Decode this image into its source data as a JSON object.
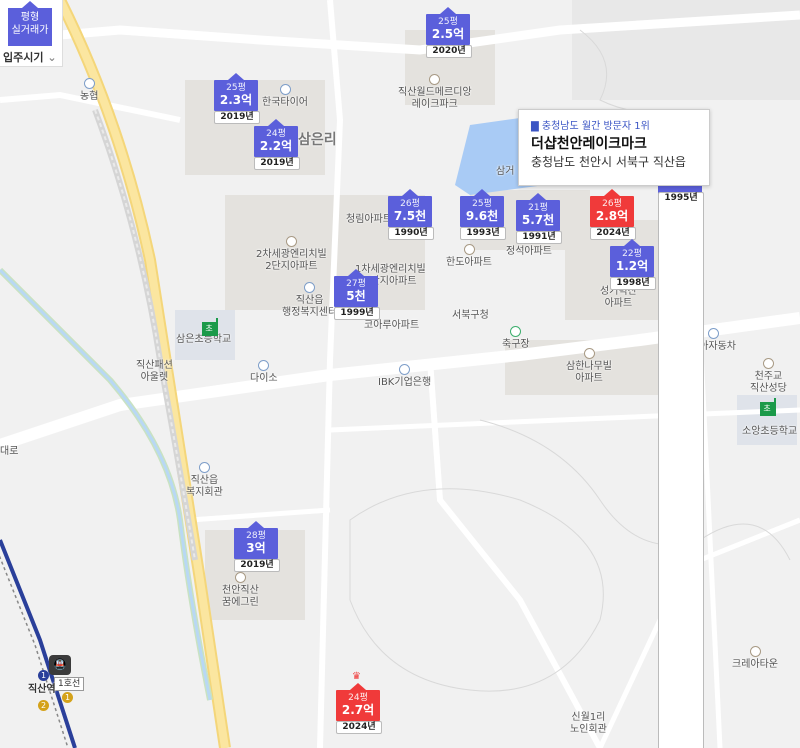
{
  "filter": {
    "type_line1": "평형",
    "type_line2": "실거래가",
    "sort_label": "입주시기",
    "sort_icon": "chevron-down-icon"
  },
  "popup": {
    "rank_icon": "building-icon",
    "rank_text": "충청남도 월간 방문자 1위",
    "name": "더샵천안레이크마크",
    "address": "충청남도 천안시 서북구 직산읍"
  },
  "markers": [
    {
      "pyeong": "25평",
      "price": "2.5억",
      "year": "2020년",
      "highlight": false
    },
    {
      "pyeong": "25평",
      "price": "2.3억",
      "year": "2019년",
      "highlight": false
    },
    {
      "pyeong": "24평",
      "price": "2.2억",
      "year": "2019년",
      "highlight": false
    },
    {
      "pyeong": "26평",
      "price": "7.5천",
      "year": "1990년",
      "highlight": false
    },
    {
      "pyeong": "25평",
      "price": "9.6천",
      "year": "1993년",
      "highlight": false
    },
    {
      "pyeong": "21평",
      "price": "5.7천",
      "year": "1991년",
      "highlight": false
    },
    {
      "pyeong": "26평",
      "price": "2.8억",
      "year": "2024년",
      "highlight": true
    },
    {
      "pyeong": "22평",
      "price": "1.2억",
      "year": "1998년",
      "highlight": false
    },
    {
      "pyeong": "27평",
      "price": "5천",
      "year": "1999년",
      "highlight": false
    },
    {
      "pyeong": "28평",
      "price": "3억",
      "year": "2019년",
      "highlight": false
    },
    {
      "pyeong": "24평",
      "price": "2.7억",
      "year": "2024년",
      "highlight": true
    }
  ],
  "partial_year": "1995년",
  "places": {
    "nonghyup": "농협",
    "hankook_tire": "한국타이어",
    "samgeunri": "삼은리",
    "world_meridian_1": "직산월드메르디앙",
    "world_meridian_2": "레이크파크",
    "cheongrim": "청림아파트",
    "sejong_1": "2차세광엔리치빌",
    "sejong_2": "2단지아파트",
    "sejong3_1": "1차세광엔리치빌",
    "sejong3_2": "1단지아파트",
    "office_1": "직산읍",
    "office_2": "행정복지센터",
    "handoo": "한도아파트",
    "jeongseok": "정석아파트",
    "seogeo_1": "성거벽산",
    "seogeo_2": "아파트",
    "korea_apt": "코아루아파트",
    "seobuk_police": "서북구청",
    "soccer": "축구장",
    "samhan_1": "삼한나무빌",
    "samhan_2": "아파트",
    "kia": "기아자동차",
    "catholic_1": "천주교",
    "catholic_2": "직산성당",
    "soyang_school": "소앙초등학교",
    "samsung_school": "삼은초등학교",
    "jiksan_1": "직산패션",
    "jiksan_2": "아울렛",
    "daiso": "다이소",
    "ibk": "IBK기업은행",
    "welfare_1": "직산읍",
    "welfare_2": "복지회관",
    "dream_1": "천안직산",
    "dream_2": "꿈에그린",
    "crea": "크레아타운",
    "sinwol_1": "신월1리",
    "sinwol_2": "노인회관",
    "station": "직산역",
    "line": "1호선",
    "samgeo_lake": "삼거",
    "road_left": "대로"
  }
}
